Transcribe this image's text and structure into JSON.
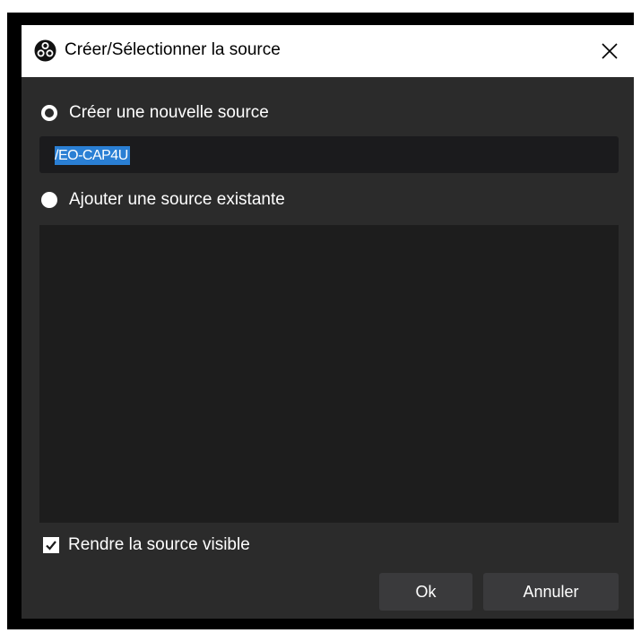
{
  "window": {
    "title": "Créer/Sélectionner la source",
    "logo_icon": "obs-logo-icon",
    "close_icon": "close-icon"
  },
  "options": {
    "create_new_label": "Créer une nouvelle source",
    "create_new_selected": true,
    "add_existing_label": "Ajouter une source existante",
    "add_existing_selected": false
  },
  "name_input": {
    "value": "VEO-CAP4U",
    "displayed_value": "/EO-CAP4U",
    "selected": true
  },
  "existing_sources": {
    "items": []
  },
  "visible_checkbox": {
    "label": "Rendre la source visible",
    "checked": true
  },
  "buttons": {
    "ok_label": "Ok",
    "cancel_label": "Annuler"
  },
  "colors": {
    "background": "#2b2b2b",
    "field_background": "#1b1b1d",
    "list_background": "#1d1d1d",
    "button_background": "#3a3a3c",
    "selection": "#2a7fd4",
    "text": "#ffffff"
  }
}
